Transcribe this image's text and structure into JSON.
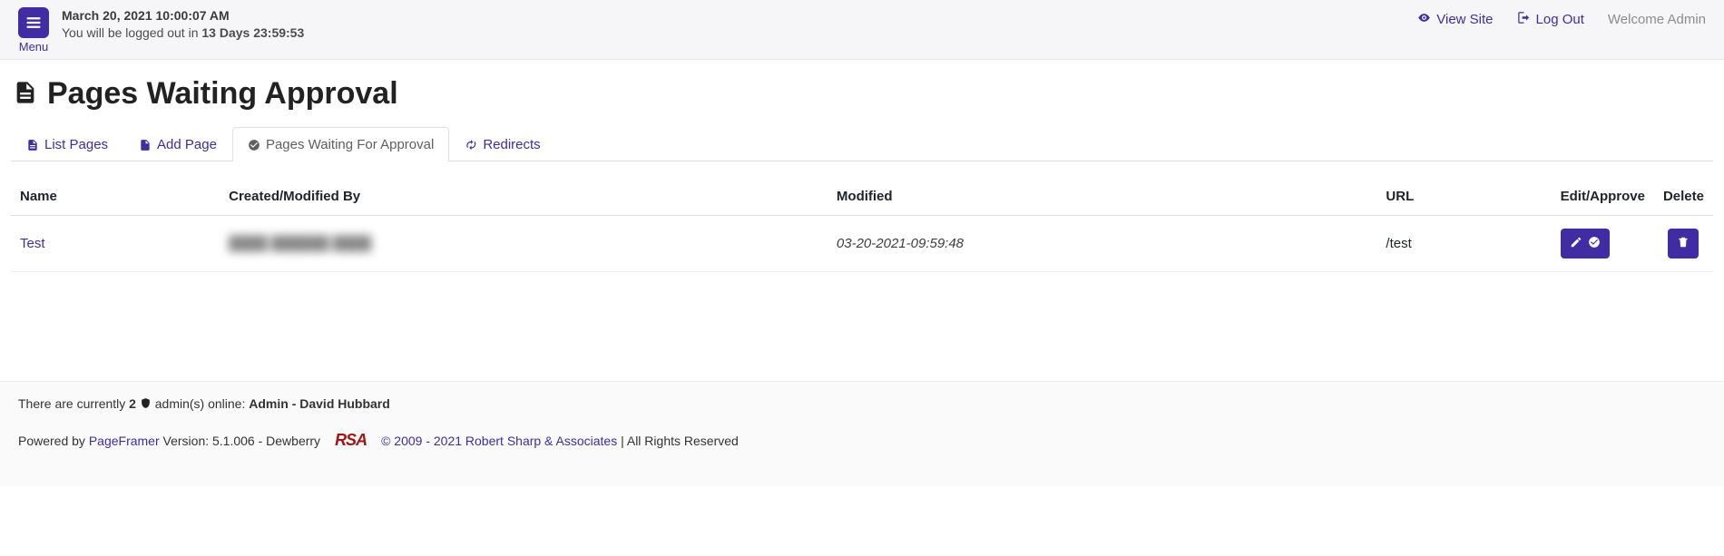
{
  "header": {
    "menu_label": "Menu",
    "datetime": "March 20, 2021 10:00:07 AM",
    "logout_prefix": "You will be logged out in ",
    "logout_countdown": "13 Days 23:59:53",
    "view_site": "View Site",
    "log_out": "Log Out",
    "welcome": "Welcome Admin"
  },
  "page": {
    "title": "Pages Waiting Approval"
  },
  "tabs": {
    "list_pages": "List Pages",
    "add_page": "Add Page",
    "waiting": "Pages Waiting For Approval",
    "redirects": "Redirects"
  },
  "table": {
    "headers": {
      "name": "Name",
      "created_by": "Created/Modified By",
      "modified": "Modified",
      "url": "URL",
      "edit_approve": "Edit/Approve",
      "delete": "Delete"
    },
    "rows": [
      {
        "name": "Test",
        "created_by": "████ ██████ ████",
        "modified": "03-20-2021-09:59:48",
        "url": "/test"
      }
    ]
  },
  "footer": {
    "online_prefix": "There are currently ",
    "online_count": "2",
    "online_mid": " admin(s) online: ",
    "online_names": "Admin - David Hubbard",
    "powered_prefix": "Powered by ",
    "pageframer": "PageFramer",
    "version_text": " Version: 5.1.006 - Dewberry",
    "rsa_logo": "RSA",
    "copyright_link": "© 2009 - 2021 Robert Sharp & Associates",
    "rights": " | All Rights Reserved"
  }
}
